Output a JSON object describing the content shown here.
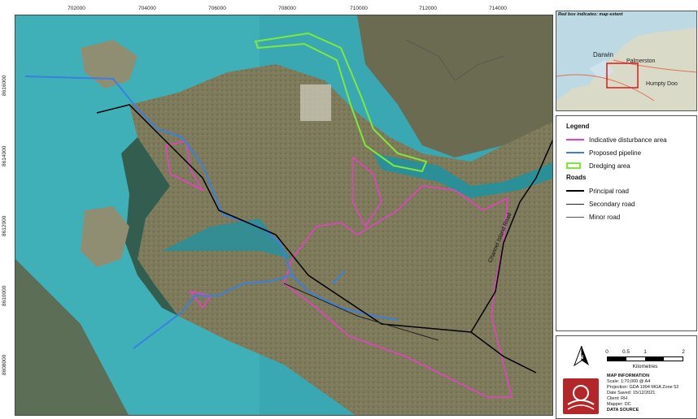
{
  "map": {
    "easting_ticks": [
      "702000",
      "704000",
      "706000",
      "708000",
      "710000",
      "712000",
      "714000"
    ],
    "northing_ticks": [
      "8616000",
      "8614000",
      "8612000",
      "8610000",
      "8608000"
    ],
    "road_label": "Channel Island Road"
  },
  "inset": {
    "caption": "Red box indicates: map extent",
    "places": [
      "Darwin",
      "Palmerston",
      "Humpty Doo"
    ]
  },
  "legend": {
    "title": "Legend",
    "items": [
      {
        "label": "Indicative disturbance area",
        "color": "#e83fc6",
        "symbol": "line"
      },
      {
        "label": "Proposed pipeline",
        "color": "#3b7fe0",
        "symbol": "line"
      },
      {
        "label": "Dredging area",
        "color": "#7dea3a",
        "symbol": "box"
      }
    ],
    "roads_title": "Roads",
    "roads": [
      {
        "label": "Principal road",
        "color": "#000000"
      },
      {
        "label": "Secondary road",
        "color": "#222222"
      },
      {
        "label": "Minor road",
        "color": "#555555"
      }
    ]
  },
  "scale": {
    "labels": [
      "0",
      "0.5",
      "1",
      "2"
    ],
    "unit": "Kilometres"
  },
  "map_info": {
    "heading": "MAP INFORMATION",
    "scale": "Scale: 1:70,000 @ A4",
    "projection": "Projection: GDA 1994 MGA Zone 52",
    "date": "Date Saved: 15/12/2021",
    "client": "Client: RH",
    "mapper": "Mapper: DC",
    "data_source": "DATA SOURCE"
  }
}
